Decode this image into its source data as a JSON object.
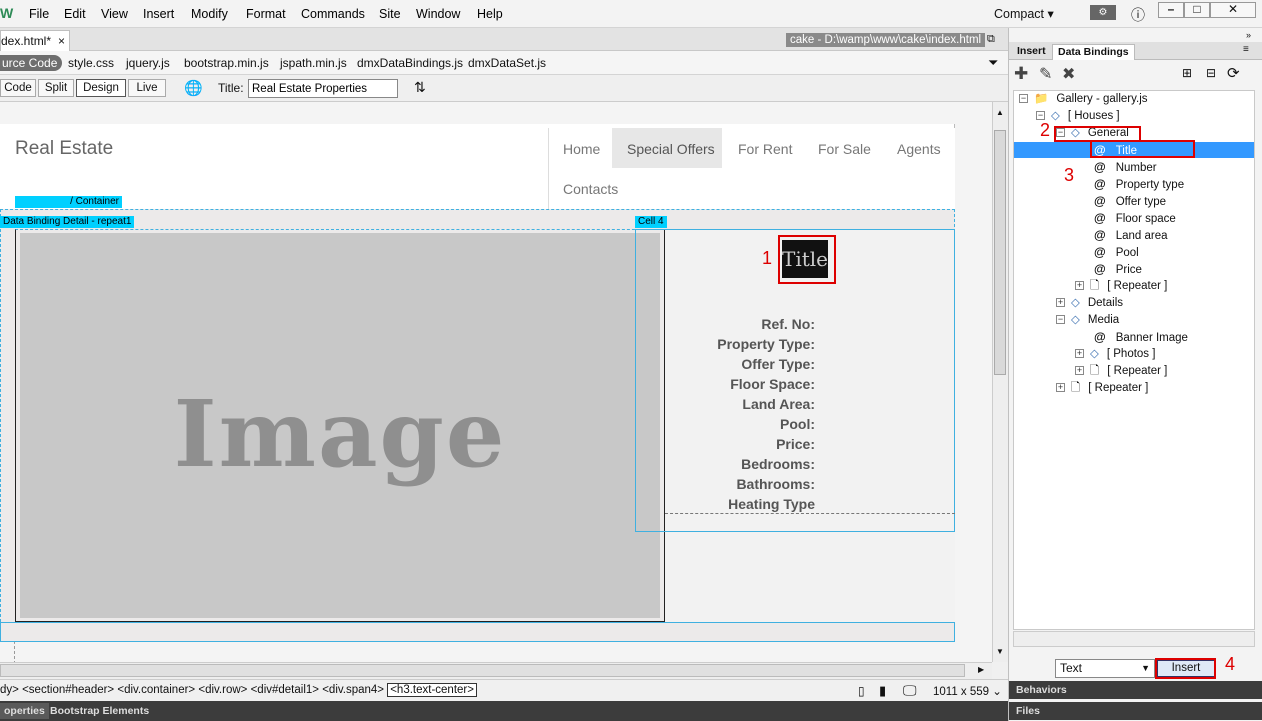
{
  "app": {
    "logo": "W",
    "compact_label": "Compact"
  },
  "menu": [
    "File",
    "Edit",
    "View",
    "Insert",
    "Modify",
    "Format",
    "Commands",
    "Site",
    "Window",
    "Help"
  ],
  "doc": {
    "tab_label": "dex.html*",
    "tab_close": "×",
    "path": "cake - D:\\wamp\\www\\cake\\index.html",
    "source_code": "urce Code",
    "related_files": [
      "style.css",
      "jquery.js",
      "bootstrap.min.js",
      "jspath.min.js",
      "dmxDataBindings.js",
      "dmxDataSet.js"
    ],
    "views": [
      "Code",
      "Split",
      "Design",
      "Live"
    ],
    "active_view": "Design",
    "title_label": "Title:",
    "title_value": "Real Estate Properties"
  },
  "page": {
    "brand": "Real Estate",
    "nav": [
      "Home",
      "Special Offers",
      "For Rent",
      "For Sale",
      "Agents",
      "Contacts"
    ],
    "container_tag": "/ Container",
    "detail_tag": "Data Binding Detail - repeat1",
    "cell_tag": "Cell 4",
    "image_placeholder": "Image",
    "title_chip": "Title",
    "props": [
      "Ref. No:",
      "Property Type:",
      "Offer Type:",
      "Floor Space:",
      "Land Area:",
      "Pool:",
      "Price:",
      "Bedrooms:",
      "Bathrooms:",
      "Heating Type"
    ]
  },
  "annotations": [
    "1",
    "2",
    "3",
    "4"
  ],
  "status": {
    "tagpath": [
      "dy>",
      "<section#header>",
      "<div.container>",
      "<div.row>",
      "<div#detail1>",
      "<div.span4>",
      "<h3.text-center>"
    ],
    "dims": "1011 x 559 ⌄"
  },
  "bottom_tabs": [
    "operties",
    "Bootstrap Elements"
  ],
  "panel": {
    "tabs": [
      "Insert",
      "Data Bindings"
    ],
    "tree": {
      "root": "Gallery - gallery.js",
      "houses": "[ Houses ]",
      "general": "General",
      "general_items": [
        "Title",
        "Number",
        "Property type",
        "Offer type",
        "Floor space",
        "Land area",
        "Pool",
        "Price"
      ],
      "general_repeater": "[ Repeater ]",
      "details": "Details",
      "media": "Media",
      "media_items": [
        "Banner Image"
      ],
      "photos": "[ Photos ]",
      "media_repeater": "[ Repeater ]",
      "root_repeater": "[ Repeater ]"
    },
    "insert_as": "Text",
    "insert_button": "Insert",
    "behaviors": "Behaviors",
    "files": "Files"
  }
}
